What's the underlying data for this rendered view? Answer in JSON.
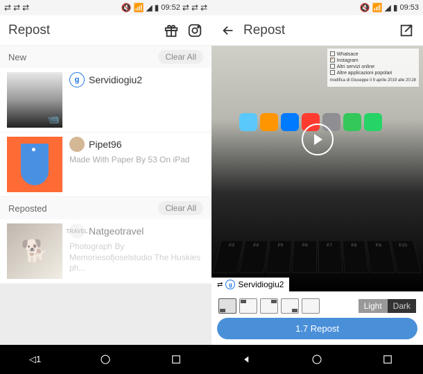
{
  "left": {
    "status": {
      "time": "09:52"
    },
    "title": "Repost",
    "sections": {
      "new": {
        "label": "New",
        "clear": "Clear All"
      },
      "reposted": {
        "label": "Reposted",
        "clear": "Clear All"
      }
    },
    "items": [
      {
        "user": "Servidiogiu2",
        "avatar": "gs",
        "caption": ""
      },
      {
        "user": "Pipet96",
        "avatar": "pipet",
        "caption": "Made With Paper By 53 On iPad"
      }
    ],
    "reposted_items": [
      {
        "user": "Natgeotravel",
        "avatar": "nat",
        "caption": "Photograph By Memoriesofjoselstudio The Huskies ph..."
      }
    ]
  },
  "right": {
    "status": {
      "time": "09:53"
    },
    "title": "Repost",
    "attribution": {
      "user": "Servidiogiu2"
    },
    "checklist": [
      "Whatsace",
      "Instagram",
      "Altri servizi online",
      "Altre applicazioni popolari"
    ],
    "meta_line": "modifica di Giuseppe il 9 aprile 2019 alle 20:28",
    "theme": {
      "light": "Light",
      "dark": "Dark"
    },
    "repost_btn": "1.7 Repost"
  },
  "nav": {
    "back": "◁",
    "home": "○",
    "recent": "□"
  }
}
